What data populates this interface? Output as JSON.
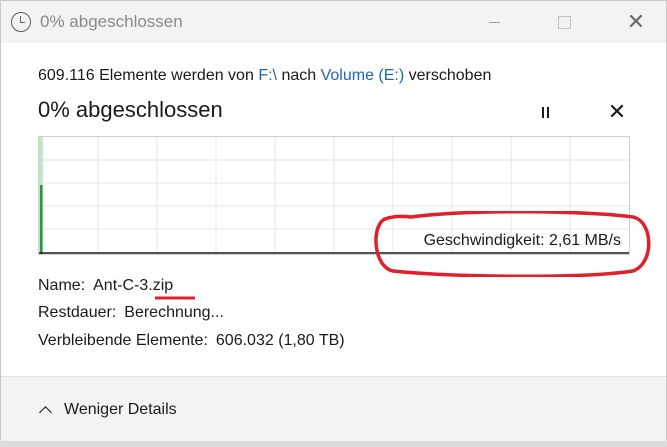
{
  "window": {
    "title": "0% abgeschlossen"
  },
  "transfer": {
    "desc_prefix": "609.116 Elemente werden von",
    "source": "F:\\",
    "desc_middle": "nach",
    "destination": "Volume (E:)",
    "desc_suffix": "verschoben",
    "progress_heading": "0% abgeschlossen",
    "progress_percent": 0
  },
  "speed": {
    "label": "Geschwindigkeit: 2,61 MB/s"
  },
  "details": {
    "name_label": "Name:",
    "name_value": "Ant-C-3.zip",
    "rest_label": "Restdauer:",
    "rest_value": "Berechnung...",
    "remaining_label": "Verbleibende Elemente:",
    "remaining_value": "606.032 (1,80 TB)"
  },
  "footer": {
    "less_details_label": "Weniger Details"
  },
  "colors": {
    "accent_green": "#1f9e3a",
    "annotation_red": "#e0202a",
    "link_blue": "#1e63b8"
  },
  "icons": {
    "title": "clock-icon",
    "pause": "pause-icon",
    "cancel": "close-icon",
    "expand": "chevron-up-icon"
  }
}
